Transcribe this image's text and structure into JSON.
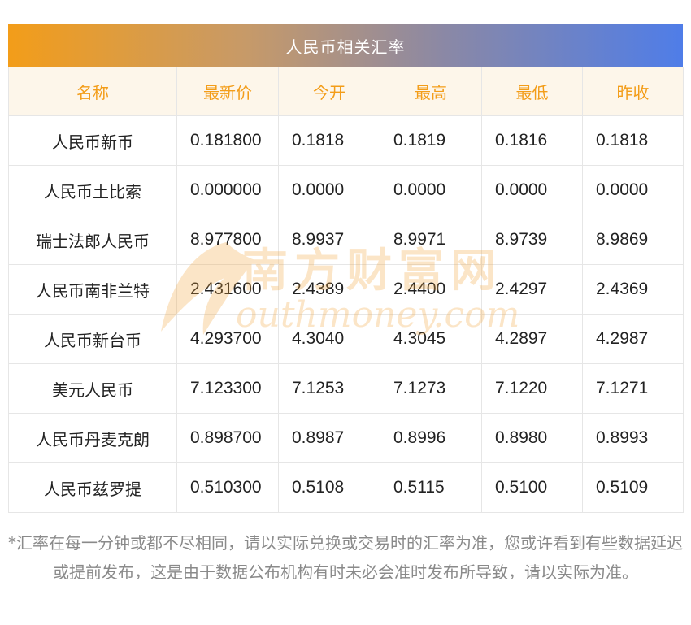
{
  "title": "人民币相关汇率",
  "columns": [
    "名称",
    "最新价",
    "今开",
    "最高",
    "最低",
    "昨收"
  ],
  "rows": [
    {
      "name": "人民币新币",
      "latest": "0.181800",
      "open": "0.1818",
      "high": "0.1819",
      "low": "0.1816",
      "prev_close": "0.1818"
    },
    {
      "name": "人民币土比索",
      "latest": "0.000000",
      "open": "0.0000",
      "high": "0.0000",
      "low": "0.0000",
      "prev_close": "0.0000"
    },
    {
      "name": "瑞士法郎人民币",
      "latest": "8.977800",
      "open": "8.9937",
      "high": "8.9971",
      "low": "8.9739",
      "prev_close": "8.9869"
    },
    {
      "name": "人民币南非兰特",
      "latest": "2.431600",
      "open": "2.4389",
      "high": "2.4400",
      "low": "2.4297",
      "prev_close": "2.4369"
    },
    {
      "name": "人民币新台币",
      "latest": "4.293700",
      "open": "4.3040",
      "high": "4.3045",
      "low": "4.2897",
      "prev_close": "4.2987"
    },
    {
      "name": "美元人民币",
      "latest": "7.123300",
      "open": "7.1253",
      "high": "7.1273",
      "low": "7.1220",
      "prev_close": "7.1271"
    },
    {
      "name": "人民币丹麦克朗",
      "latest": "0.898700",
      "open": "0.8987",
      "high": "0.8996",
      "low": "0.8980",
      "prev_close": "0.8993"
    },
    {
      "name": "人民币兹罗提",
      "latest": "0.510300",
      "open": "0.5108",
      "high": "0.5115",
      "low": "0.5100",
      "prev_close": "0.5109"
    }
  ],
  "watermark": {
    "cn": "南方财富网",
    "en": "outhmoney.com",
    "color": "#f2a33a"
  },
  "note": "*汇率在每一分钟或都不尽相同，请以实际兑换或交易时的汇率为准，您或许看到有些数据延迟或提前发布，这是由于数据公布机构有时未必会准时发布所导致，请以实际为准。",
  "colors": {
    "accent": "#f39d19",
    "header_bg": "#fdf6ea",
    "gradient_end": "#4f7de8"
  }
}
